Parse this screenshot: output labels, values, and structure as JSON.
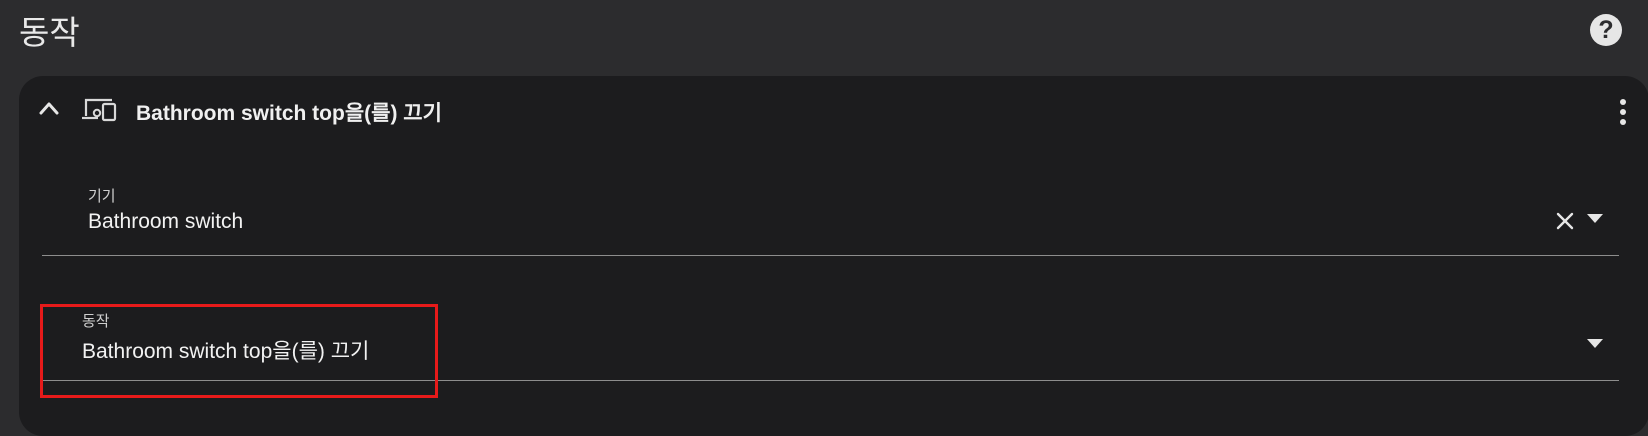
{
  "section": {
    "title": "동작",
    "help_icon": "help-circle-icon"
  },
  "card": {
    "header_title": "Bathroom switch top을(를) 끄기",
    "collapse_icon": "chevron-up-icon",
    "type_icon": "devices-icon",
    "menu_icon": "more-vertical-icon"
  },
  "fields": {
    "device": {
      "label": "기기",
      "value": "Bathroom switch"
    },
    "action": {
      "label": "동작",
      "value": "Bathroom switch top을(를) 끄기"
    }
  },
  "colors": {
    "background": "#2c2c2e",
    "card": "#1c1c1e",
    "text": "#f0f0f0",
    "divider": "#8d8d8d",
    "highlight": "#e61a1a"
  }
}
